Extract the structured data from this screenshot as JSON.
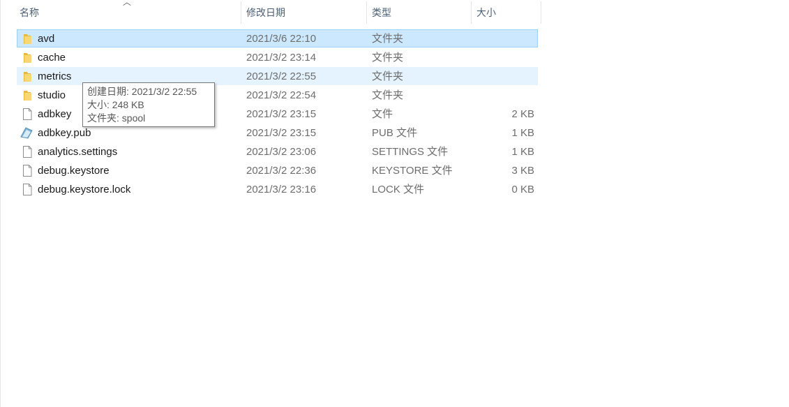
{
  "columns": {
    "name": "名称",
    "date": "修改日期",
    "type": "类型",
    "size": "大小"
  },
  "files": [
    {
      "name": "avd",
      "date": "2021/3/6 22:10",
      "type": "文件夹",
      "size": "",
      "icon": "folder-icon",
      "state": "selected"
    },
    {
      "name": "cache",
      "date": "2021/3/2 23:14",
      "type": "文件夹",
      "size": "",
      "icon": "folder-icon",
      "state": ""
    },
    {
      "name": "metrics",
      "date": "2021/3/2 22:55",
      "type": "文件夹",
      "size": "",
      "icon": "folder-icon",
      "state": "hover"
    },
    {
      "name": "studio",
      "date": "2021/3/2 22:54",
      "type": "文件夹",
      "size": "",
      "icon": "folder-icon",
      "state": ""
    },
    {
      "name": "adbkey",
      "date": "2021/3/2 23:15",
      "type": "文件",
      "size": "2 KB",
      "icon": "file-icon",
      "state": ""
    },
    {
      "name": "adbkey.pub",
      "date": "2021/3/2 23:15",
      "type": "PUB 文件",
      "size": "1 KB",
      "icon": "pub-file-icon",
      "state": ""
    },
    {
      "name": "analytics.settings",
      "date": "2021/3/2 23:06",
      "type": "SETTINGS 文件",
      "size": "1 KB",
      "icon": "file-icon",
      "state": ""
    },
    {
      "name": "debug.keystore",
      "date": "2021/3/2 22:36",
      "type": "KEYSTORE 文件",
      "size": "3 KB",
      "icon": "file-icon",
      "state": ""
    },
    {
      "name": "debug.keystore.lock",
      "date": "2021/3/2 23:16",
      "type": "LOCK 文件",
      "size": "0 KB",
      "icon": "file-icon",
      "state": ""
    }
  ],
  "tooltip": {
    "created": "创建日期: 2021/3/2 22:55",
    "size": "大小: 248 KB",
    "folder": "文件夹: spool"
  },
  "colors": {
    "selected_bg": "#cce8ff",
    "selected_border": "#99d1ff",
    "hover_bg": "#e5f3ff",
    "folder": "#f8d775"
  }
}
